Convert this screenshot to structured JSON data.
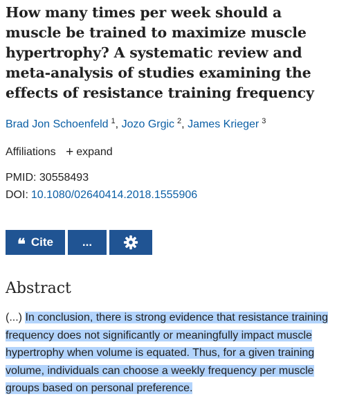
{
  "article": {
    "title": "How many times per week should a muscle be trained to maximize muscle hypertrophy? A systematic review and meta-analysis of studies examining the effects of resistance training frequency",
    "authors": [
      {
        "name": "Brad Jon Schoenfeld",
        "sup": "1"
      },
      {
        "name": "Jozo Grgic",
        "sup": "2"
      },
      {
        "name": "James Krieger",
        "sup": "3"
      }
    ],
    "separator": ",",
    "affiliations_label": "Affiliations",
    "expand_label": "expand",
    "pmid_label": "PMID:",
    "pmid_value": "30558493",
    "doi_label": "DOI:",
    "doi_value": "10.1080/02640414.2018.1555906"
  },
  "actions": {
    "cite_label": "Cite",
    "more_label": "...",
    "cite_icon": "quote-icon",
    "settings_icon": "gear-icon",
    "button_color": "#205493"
  },
  "abstract": {
    "heading": "Abstract",
    "prefix": "(...)",
    "text": "In conclusion, there is strong evidence that resistance training frequency does not significantly or meaningfully impact muscle hypertrophy when volume is equated. Thus, for a given training volume, individuals can choose a weekly frequency per muscle groups based on personal preference.",
    "highlight_color": "#b3d4fc"
  }
}
